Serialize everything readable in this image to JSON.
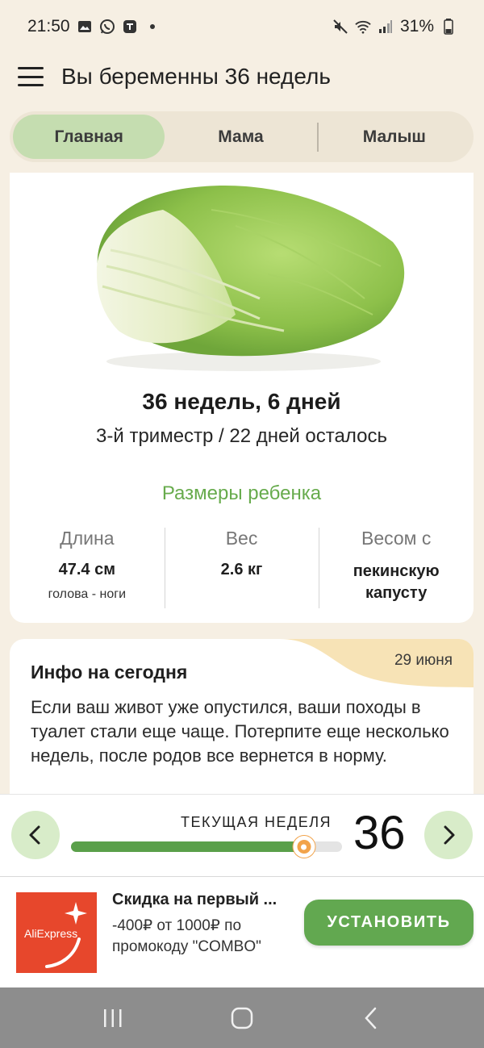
{
  "status": {
    "time": "21:50",
    "battery": "31%",
    "left_icons": [
      "image-icon",
      "whatsapp-icon",
      "shield-icon",
      "dot-icon"
    ],
    "right_icons": [
      "mute-icon",
      "wifi-icon",
      "signal-icon",
      "battery-icon"
    ]
  },
  "appbar": {
    "title": "Вы беременны 36 недель"
  },
  "tabs": [
    {
      "label": "Главная",
      "active": true
    },
    {
      "label": "Мама",
      "active": false
    },
    {
      "label": "Малыш",
      "active": false
    }
  ],
  "main": {
    "weeks_days": "36 недель, 6 дней",
    "trimester": "3-й триместр / 22 дней осталось",
    "sizes_title": "Размеры ребенка",
    "metrics": [
      {
        "label": "Длина",
        "value": "47.4 см",
        "sub": "голова - ноги"
      },
      {
        "label": "Вес",
        "value": "2.6 кг",
        "sub": ""
      },
      {
        "label": "Весом с",
        "value": "пекинскую капусту",
        "sub": ""
      }
    ]
  },
  "info": {
    "date": "29 июня",
    "heading": "Инфо на сегодня",
    "text": "Если ваш живот уже опустился, ваши походы в туалет стали еще чаще. Потерпите еще несколько недель, после родов все вернется в норму."
  },
  "week_bar": {
    "label": "ТЕКУЩАЯ НЕДЕЛЯ",
    "number": "36",
    "progress": 0.86
  },
  "ad": {
    "brand": "AliExpress",
    "title": "Скидка на первый ...",
    "text": "-400₽ от 1000₽ по промокоду \"COMBO\"",
    "button": "УСТАНОВИТЬ"
  },
  "colors": {
    "background": "#f6efe3",
    "accent_green": "#62a850",
    "tab_active": "#c5ddb0",
    "thumb_orange": "#f2a34a",
    "date_badge": "#f7e3b6",
    "ad_red": "#e7472c"
  }
}
